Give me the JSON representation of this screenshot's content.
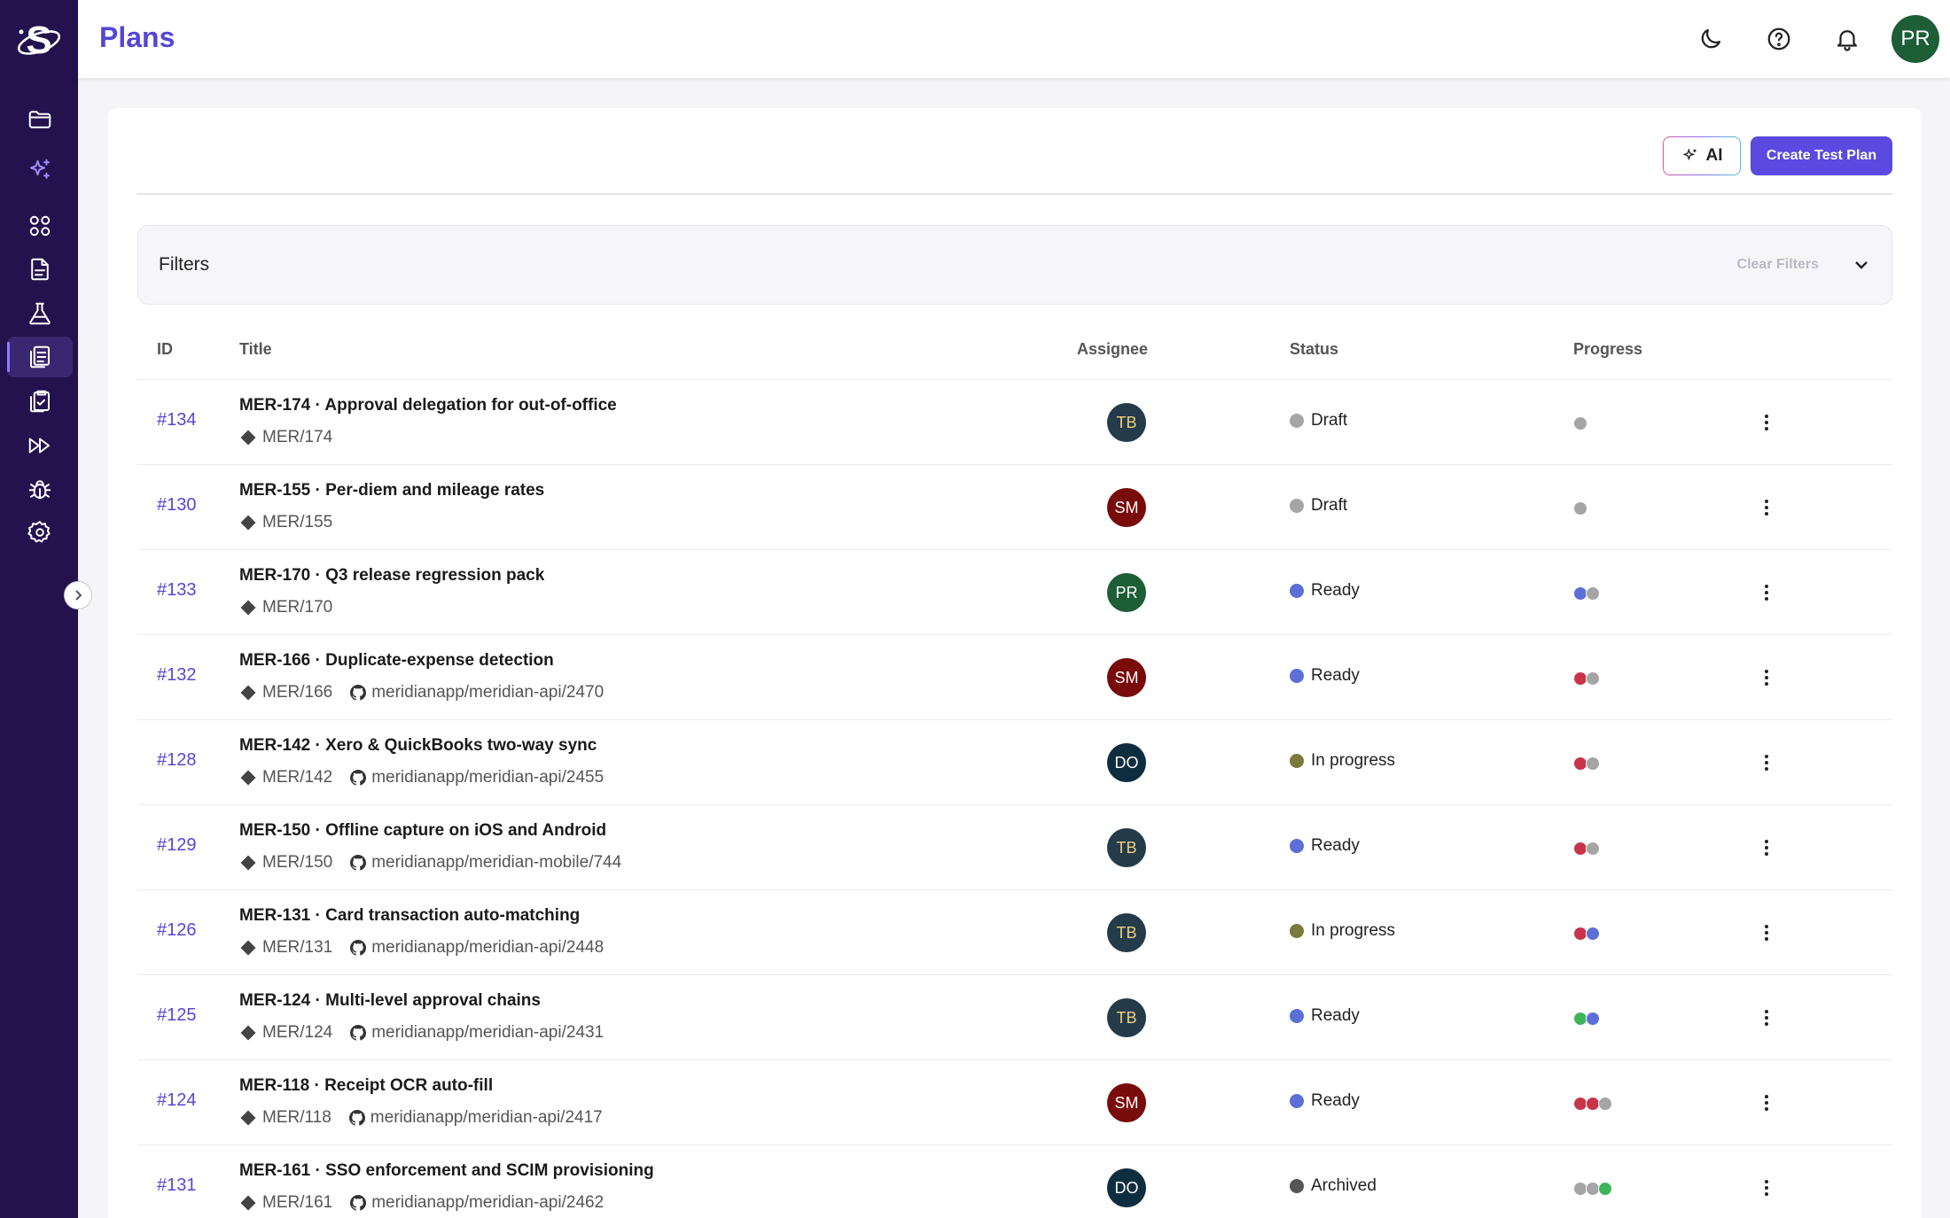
{
  "app": {
    "title": "Plans"
  },
  "header": {
    "user_initials": "PR"
  },
  "sidebar": {
    "items": [
      {
        "name": "folder-icon"
      },
      {
        "name": "ai-sparkles-icon"
      },
      {
        "name": "grid-icon"
      },
      {
        "name": "document-icon"
      },
      {
        "name": "flask-icon"
      },
      {
        "name": "plans-clipboard-icon"
      },
      {
        "name": "clipboard-check-icon"
      },
      {
        "name": "fast-forward-icon"
      },
      {
        "name": "bug-icon"
      },
      {
        "name": "gear-icon"
      }
    ]
  },
  "toolbar": {
    "ai_label": "AI",
    "create_label": "Create Test Plan"
  },
  "filters": {
    "label": "Filters",
    "clear_label": "Clear Filters"
  },
  "table": {
    "headers": {
      "id": "ID",
      "title": "Title",
      "assignee": "Assignee",
      "status": "Status",
      "progress": "Progress"
    },
    "rows": [
      {
        "id": "#134",
        "title": "MER-174 · Approval delegation for out-of-office",
        "ref": "MER/174",
        "repo": "",
        "assignee": "TB",
        "status": "Draft",
        "status_color": "#a5a5a5",
        "progress": [
          "#a5a5a5"
        ]
      },
      {
        "id": "#130",
        "title": "MER-155 · Per-diem and mileage rates",
        "ref": "MER/155",
        "repo": "",
        "assignee": "SM",
        "status": "Draft",
        "status_color": "#a5a5a5",
        "progress": [
          "#a5a5a5"
        ]
      },
      {
        "id": "#133",
        "title": "MER-170 · Q3 release regression pack",
        "ref": "MER/170",
        "repo": "",
        "assignee": "PR",
        "status": "Ready",
        "status_color": "#5b6fd6",
        "progress": [
          "#5b6fd6",
          "#a5a5a5"
        ]
      },
      {
        "id": "#132",
        "title": "MER-166 · Duplicate-expense detection",
        "ref": "MER/166",
        "repo": "meridianapp/meridian-api/2470",
        "assignee": "SM",
        "status": "Ready",
        "status_color": "#5b6fd6",
        "progress": [
          "#c8354b",
          "#a5a5a5"
        ]
      },
      {
        "id": "#128",
        "title": "MER-142 · Xero & QuickBooks two-way sync",
        "ref": "MER/142",
        "repo": "meridianapp/meridian-api/2455",
        "assignee": "DO",
        "status": "In progress",
        "status_color": "#7a7a3a",
        "progress": [
          "#c8354b",
          "#a5a5a5"
        ]
      },
      {
        "id": "#129",
        "title": "MER-150 · Offline capture on iOS and Android",
        "ref": "MER/150",
        "repo": "meridianapp/meridian-mobile/744",
        "assignee": "TB",
        "status": "Ready",
        "status_color": "#5b6fd6",
        "progress": [
          "#c8354b",
          "#a5a5a5"
        ]
      },
      {
        "id": "#126",
        "title": "MER-131 · Card transaction auto-matching",
        "ref": "MER/131",
        "repo": "meridianapp/meridian-api/2448",
        "assignee": "TB",
        "status": "In progress",
        "status_color": "#7a7a3a",
        "progress": [
          "#c8354b",
          "#5b6fd6"
        ]
      },
      {
        "id": "#125",
        "title": "MER-124 · Multi-level approval chains",
        "ref": "MER/124",
        "repo": "meridianapp/meridian-api/2431",
        "assignee": "TB",
        "status": "Ready",
        "status_color": "#5b6fd6",
        "progress": [
          "#3fb55a",
          "#5b6fd6"
        ]
      },
      {
        "id": "#124",
        "title": "MER-118 · Receipt OCR auto-fill",
        "ref": "MER/118",
        "repo": "meridianapp/meridian-api/2417",
        "assignee": "SM",
        "status": "Ready",
        "status_color": "#5b6fd6",
        "progress": [
          "#c8354b",
          "#c8354b",
          "#a5a5a5"
        ]
      },
      {
        "id": "#131",
        "title": "MER-161 · SSO enforcement and SCIM provisioning",
        "ref": "MER/161",
        "repo": "meridianapp/meridian-api/2462",
        "assignee": "DO",
        "status": "Archived",
        "status_color": "#555555",
        "progress": [
          "#a5a5a5",
          "#a5a5a5",
          "#3fb55a"
        ]
      }
    ]
  }
}
